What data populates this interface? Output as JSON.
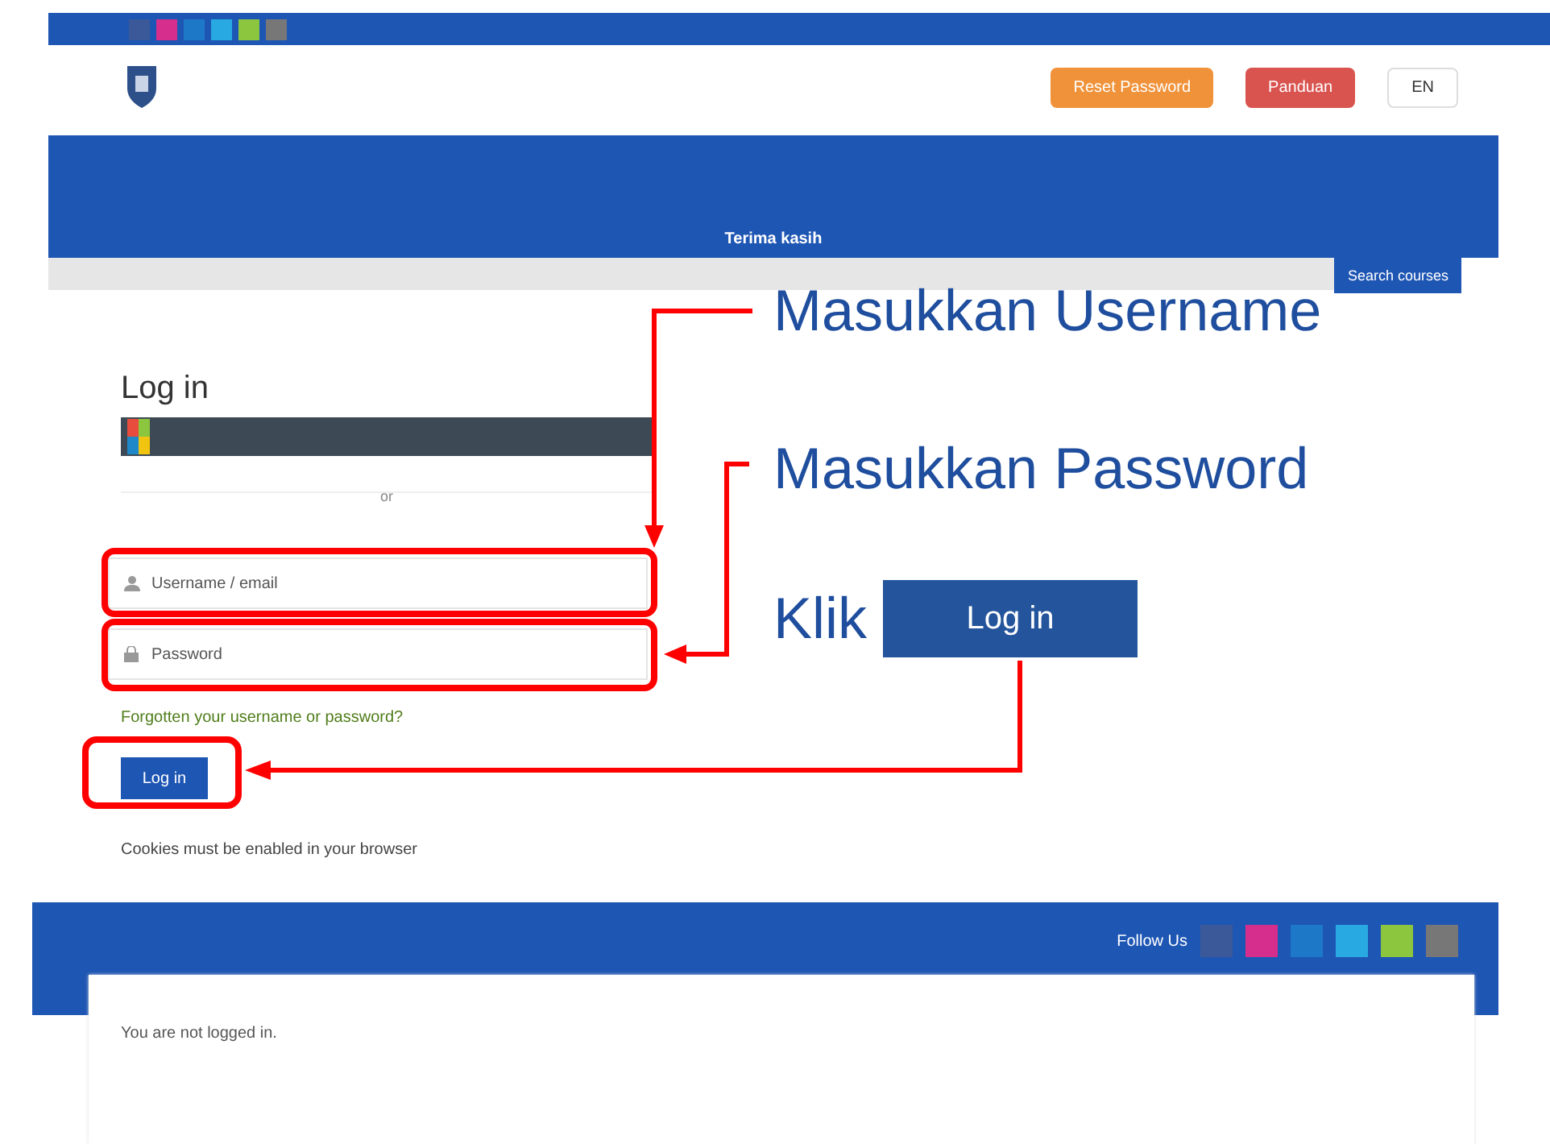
{
  "header": {
    "buttons": [
      {
        "label": "Reset Password",
        "kind": "orange"
      },
      {
        "label": "Panduan",
        "kind": "red"
      },
      {
        "label": "EN",
        "kind": "plain"
      }
    ]
  },
  "banner": {
    "closing": "Terima kasih"
  },
  "search_button": "Search courses",
  "login": {
    "title": "Log in",
    "divider": "or",
    "username_placeholder": "Username / email",
    "password_placeholder": "Password",
    "forgot_link": "Forgotten your username or password?",
    "submit": "Log in",
    "cookies_note": "Cookies must be enabled in your browser"
  },
  "footer": {
    "follow": "Follow Us",
    "status": "You are not logged in."
  },
  "annotations": {
    "username": "Masukkan Username",
    "password": "Masukkan Password",
    "click": "Klik",
    "button": "Log in"
  }
}
